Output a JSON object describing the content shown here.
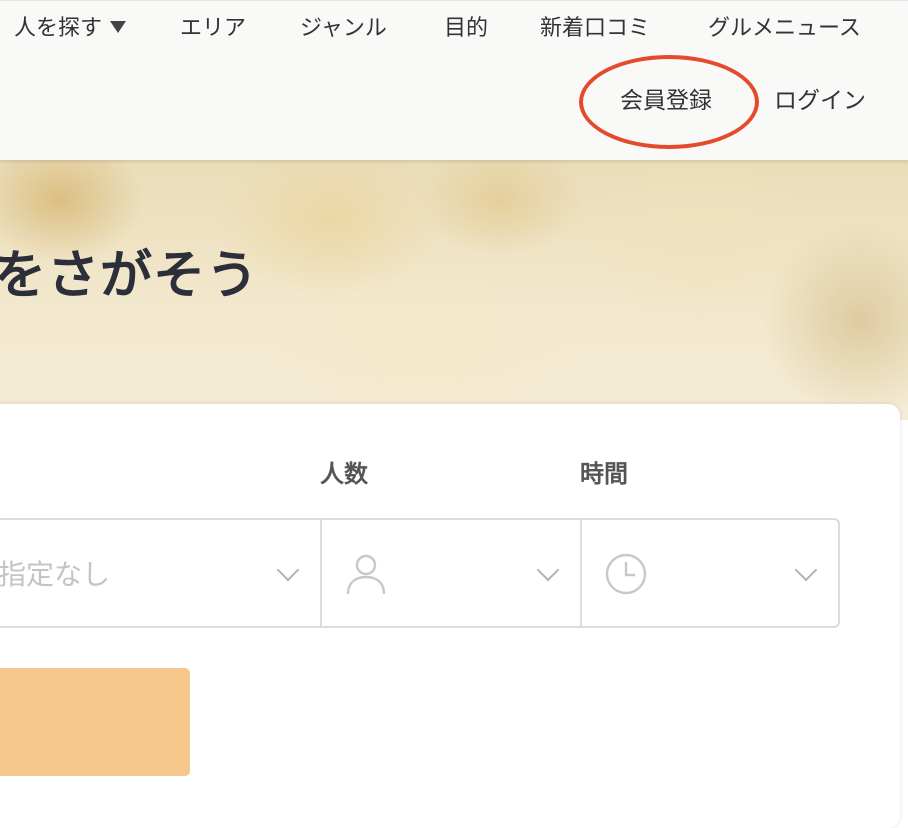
{
  "nav": {
    "people_label": "人を探す",
    "area_label": "エリア",
    "genre_label": "ジャンル",
    "purpose_label": "目的",
    "reviews_label": "新着口コミ",
    "news_label": "グルメニュース"
  },
  "auth": {
    "signup_label": "会員登録",
    "login_label": "ログイン"
  },
  "hero": {
    "title": "をさがそう"
  },
  "search": {
    "people_label": "人数",
    "time_label": "時間",
    "date_value": "指定なし"
  },
  "colors": {
    "annotation_ring": "#e34b2c",
    "search_button": "#f5c78b",
    "hero_text": "#2c2f3a"
  },
  "icons": {
    "nav_dropdown": "caret-down-icon",
    "select_dropdown": "chevron-down-icon",
    "people": "person-icon",
    "time": "clock-icon"
  }
}
